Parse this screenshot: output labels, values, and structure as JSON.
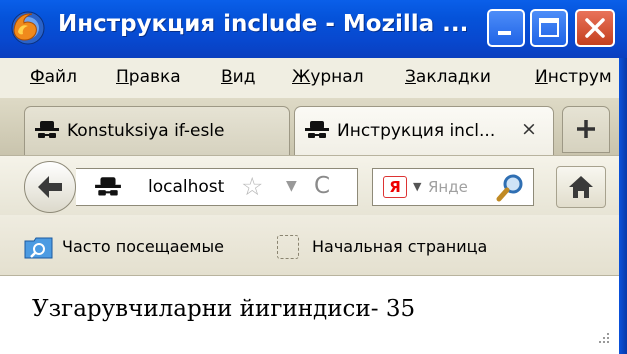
{
  "window": {
    "title": "Инструкция include - Mozilla ...",
    "icon": "firefox-icon"
  },
  "menu": {
    "items": [
      "Файл",
      "Правка",
      "Вид",
      "Журнал",
      "Закладки",
      "Инструм"
    ]
  },
  "tabs": [
    {
      "label": "Konstuksiya if-esle",
      "icon": "spy-icon",
      "active": false
    },
    {
      "label": "Инструкция incl...",
      "icon": "spy-icon",
      "active": true,
      "close": "×"
    }
  ],
  "new_tab": {
    "icon": "plus-icon",
    "label": "+"
  },
  "navbar": {
    "url": "localhost",
    "star": "☆",
    "dropdown": "▼",
    "reload": "C",
    "search_placeholder": "Янде",
    "search_engine_logo": "Я"
  },
  "bookmarks": [
    {
      "label": "Часто посещаемые",
      "icon": "smart-folder-icon"
    },
    {
      "label": "Начальная страница",
      "icon": "blank-page-icon"
    }
  ],
  "content": {
    "text": "Узгарувчиларни йигиндиси- 35"
  },
  "colors": {
    "titlebar": "#0553da",
    "chrome": "#f0eee2",
    "close_button": "#c4401f"
  }
}
